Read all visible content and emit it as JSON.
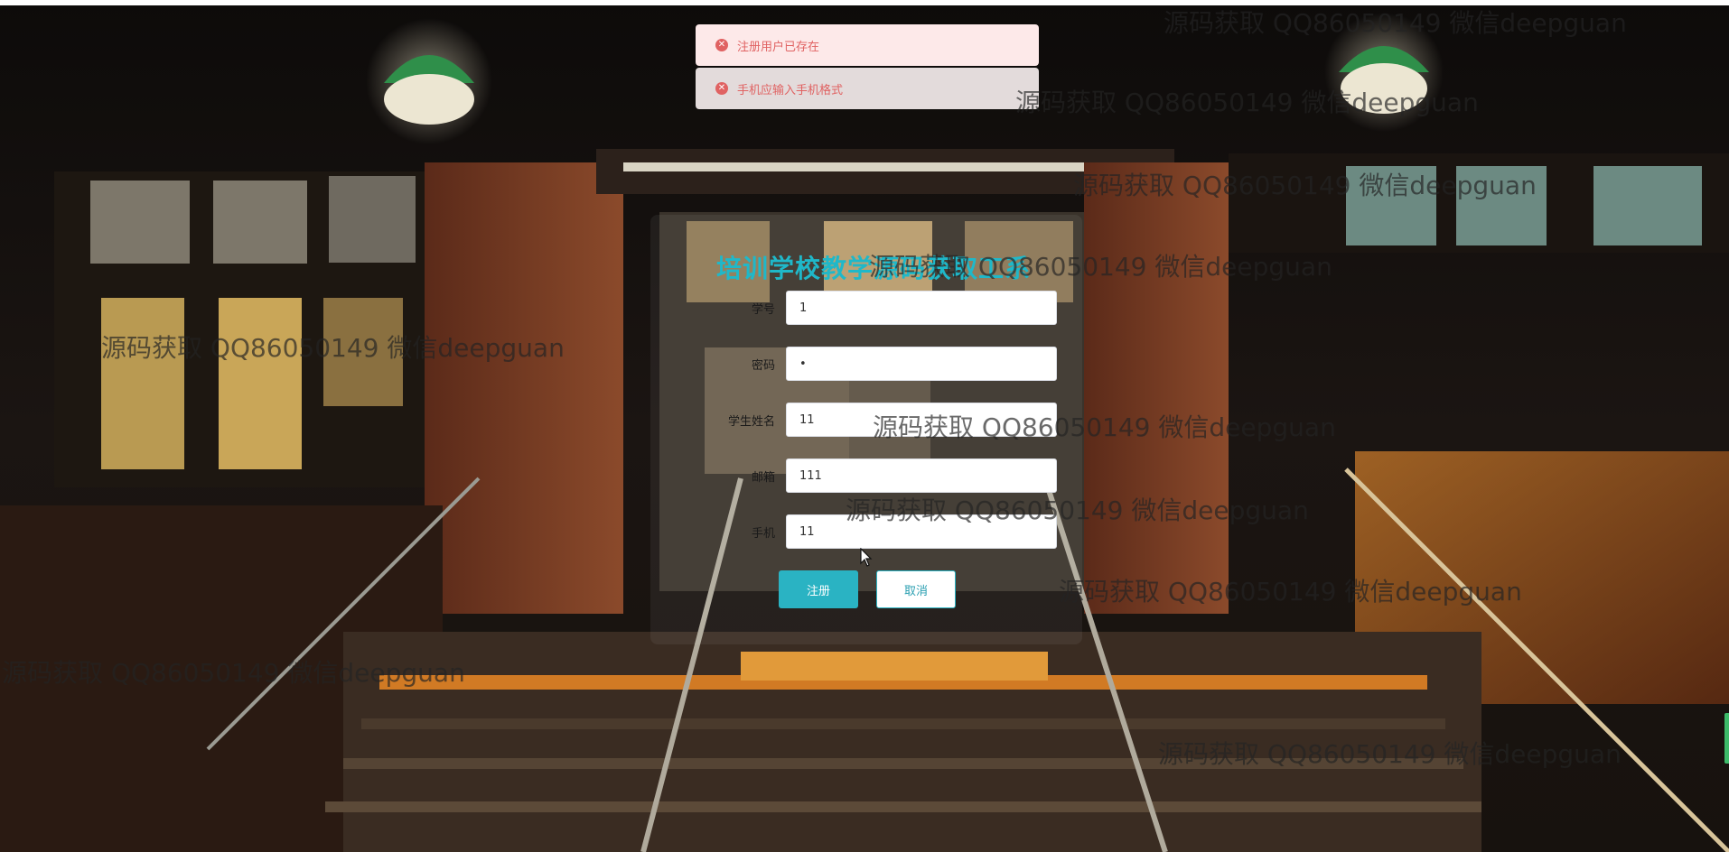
{
  "toasts": [
    {
      "text": "注册用户已存在",
      "icon": "error-circle-icon"
    },
    {
      "text": "手机应输入手机格式",
      "icon": "error-circle-icon"
    }
  ],
  "form": {
    "title": "培训学校教学源码获取工系",
    "fields": [
      {
        "label": "学号",
        "value": "1"
      },
      {
        "label": "密码",
        "value": "•"
      },
      {
        "label": "学生姓名",
        "value": "11"
      },
      {
        "label": "邮箱",
        "value": "111"
      },
      {
        "label": "手机",
        "value": "11"
      }
    ],
    "register_label": "注册",
    "cancel_label": "取消"
  },
  "watermarks": [
    "源码获取 QQ86050149 微信deepguan",
    "源码获取 QQ86050149 微信deepguan",
    "源码获取 QQ86050149 微信deepguan",
    "源码获取 QQ86050149 微信deepguan",
    "源码获取 QQ86050149 微信deepguan",
    "源码获取 QQ86050149 微信deepguan",
    "源码获取 QQ86050149 微信deepguan",
    "源码获取 QQ86050149 微信deepguan",
    "源码获取 QQ86050149 微信deepguan",
    "源码获取 QQ86050149 微信deepguan"
  ],
  "colors": {
    "accent": "#2ab3c3",
    "title": "#1fb8c9",
    "error": "#e06262"
  }
}
